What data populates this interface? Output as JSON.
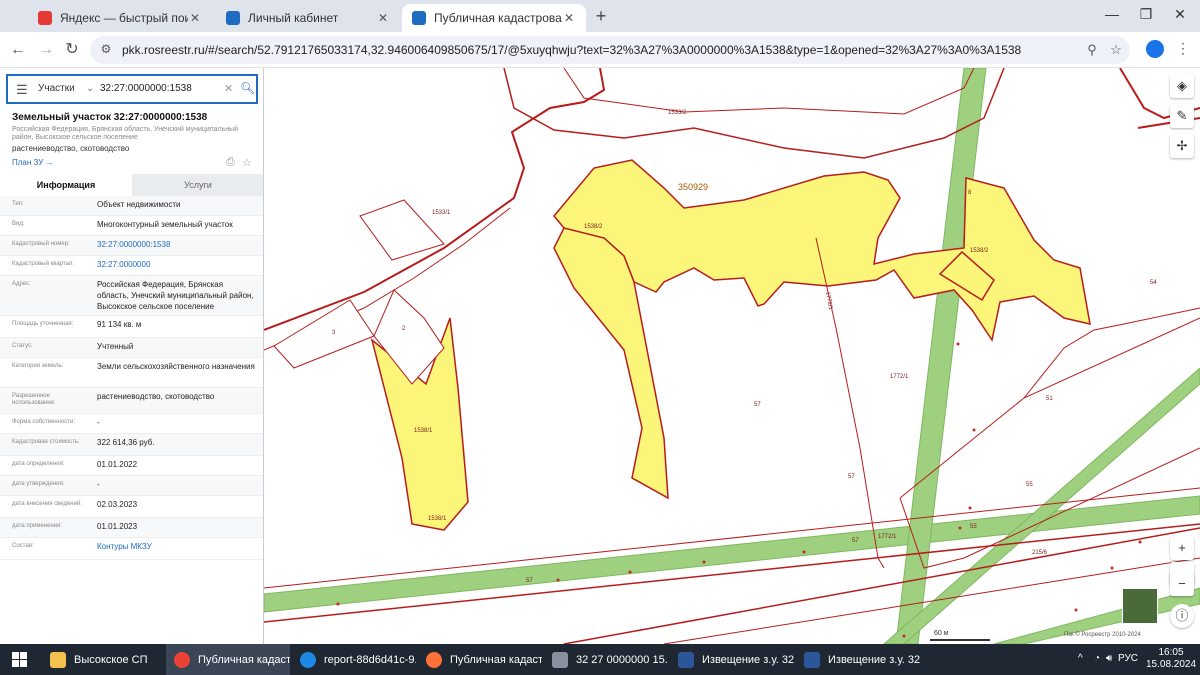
{
  "browser": {
    "tabs": [
      {
        "title": "Яндекс — быстрый поиск в и",
        "active": false
      },
      {
        "title": "Личный кабинет",
        "active": false
      },
      {
        "title": "Публичная кадастровая карта",
        "active": true
      }
    ],
    "url": "pkk.rosreestr.ru/#/search/52.79121765033174,32.946006409850675/17/@5xuyqhwju?text=32%3A27%3A0000000%3A1538&type=1&opened=32%3A27%3A0%3A1538"
  },
  "search": {
    "type_label": "Участки",
    "query": "32:27:0000000:1538"
  },
  "parcel": {
    "title": "Земельный участок 32:27:0000000:1538",
    "address": "Российская Федерация, Брянская область, Унечский муниципальный район, Высокское сельское поселение",
    "use": "растениеводство, скотоводство",
    "plan_link": "План ЗУ →"
  },
  "tabs": {
    "info": "Информация",
    "services": "Услуги"
  },
  "attributes": [
    {
      "key": "Тип:",
      "value": "Объект недвижимости"
    },
    {
      "key": "Вид:",
      "value": "Многоконтурный земельный участок"
    },
    {
      "key": "Кадастровый номер:",
      "value": "32:27:0000000:1538",
      "link": true
    },
    {
      "key": "Кадастровый квартал:",
      "value": "32:27:0000000",
      "link": true
    },
    {
      "key": "Адрес:",
      "value": "Российская Федерация, Брянская область, Унечский муниципальный район, Высокское сельское поселение"
    },
    {
      "key": "Площадь уточненная:",
      "value": "91 134 кв. м"
    },
    {
      "key": "Статус:",
      "value": "Учтенный"
    },
    {
      "key": "Категория земель:",
      "value": "Земли сельскохозяйственного назначения"
    },
    {
      "key": "Разрешенное использование:",
      "value": "растениеводство, скотоводство"
    },
    {
      "key": "Форма собственности:",
      "value": "-"
    },
    {
      "key": "Кадастровая стоимость:",
      "value": "322 614,36 руб."
    },
    {
      "key": "дата определения:",
      "value": "01.01.2022"
    },
    {
      "key": "дата утверждения:",
      "value": "-"
    },
    {
      "key": "дата внесения сведений:",
      "value": "02.03.2023"
    },
    {
      "key": "дата применения:",
      "value": "01.01.2023"
    },
    {
      "key": "Состав:",
      "value": "Контуры МКЗУ",
      "link": true
    }
  ],
  "map": {
    "labels": [
      {
        "text": "1533/2"
      },
      {
        "text": "350929"
      },
      {
        "text": "1533/1"
      },
      {
        "text": "1538/2"
      },
      {
        "text": "1538/2"
      },
      {
        "text": "8"
      },
      {
        "text": "3"
      },
      {
        "text": "2"
      },
      {
        "text": "1538/1"
      },
      {
        "text": "1538/1"
      },
      {
        "text": "1772/1"
      },
      {
        "text": "1772/1"
      },
      {
        "text": "57"
      },
      {
        "text": "57"
      },
      {
        "text": "57"
      },
      {
        "text": "57"
      },
      {
        "text": "54"
      },
      {
        "text": "51"
      },
      {
        "text": "55"
      },
      {
        "text": "55"
      },
      {
        "text": "1772/1"
      },
      {
        "text": "215/6"
      }
    ],
    "scale": "60 м",
    "copyright": "Пкк © Росреестр 2010-2024"
  },
  "taskbar": {
    "items": [
      {
        "label": "Высокское СП"
      },
      {
        "label": "Публичная кадаст..."
      },
      {
        "label": "report-88d6d41c-9..."
      },
      {
        "label": "Публичная кадаст..."
      },
      {
        "label": "32  27  0000000  15..."
      },
      {
        "label": "Извещение з.у. 32 ..."
      },
      {
        "label": "Извещение з.у. 32 ..."
      }
    ],
    "lang": "РУС",
    "time": "16:05",
    "date": "15.08.2024"
  }
}
